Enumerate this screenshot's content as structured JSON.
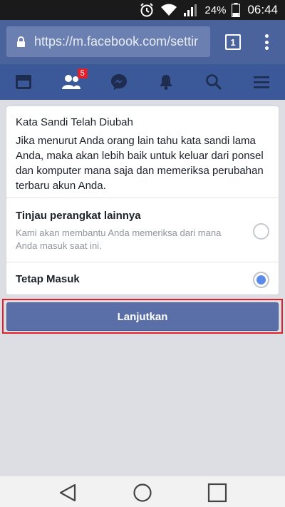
{
  "status_bar": {
    "battery_percent": "24%",
    "time": "06:44"
  },
  "browser": {
    "url": "https://m.facebook.com/settir",
    "tab_count": "1"
  },
  "fb_nav": {
    "friend_requests_badge": "5",
    "icons": [
      "news-feed-icon",
      "friends-icon",
      "messenger-icon",
      "notifications-icon",
      "search-icon",
      "menu-icon"
    ]
  },
  "card": {
    "title": "Kata Sandi Telah Diubah",
    "description": "Jika menurut Anda orang lain tahu kata sandi lama Anda, maka akan lebih baik untuk keluar dari ponsel dan komputer mana saja dan memeriksa perubahan terbaru akun Anda.",
    "options": [
      {
        "title": "Tinjau perangkat lainnya",
        "subtitle": "Kami akan membantu Anda memeriksa dari mana Anda masuk saat ini.",
        "selected": false
      },
      {
        "title": "Tetap Masuk",
        "subtitle": "",
        "selected": true
      }
    ]
  },
  "continue_label": "Lanjutkan",
  "colors": {
    "fb_blue": "#3b5998",
    "browser_bar": "#4b639c",
    "button": "#5a6fa7",
    "radio_selected": "#5b8be8",
    "highlight": "#e0202a"
  }
}
